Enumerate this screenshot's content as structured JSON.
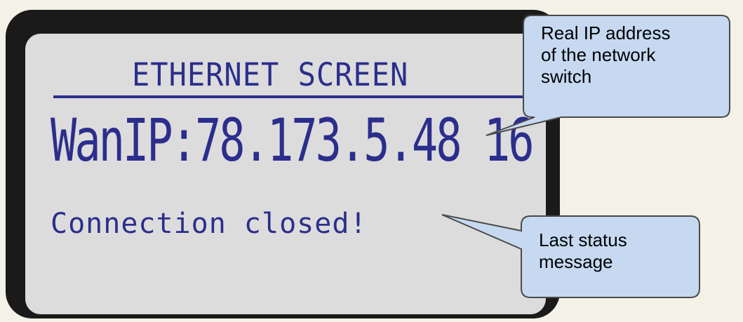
{
  "lcd": {
    "title": "ETHERNET SCREEN",
    "wan_ip_line": "WanIP:78.173.5.48 16",
    "status_line": "Connection closed!"
  },
  "callouts": {
    "ip_note_line1": "Real IP address",
    "ip_note_line2": "of the network",
    "ip_note_line3": "switch",
    "status_note_line1": "Last status",
    "status_note_line2": "message"
  },
  "colors": {
    "lcd_text": "#2b2e8c",
    "lcd_background": "#dcdcdc",
    "frame": "#1a1a1a",
    "callout_fill": "#c6d9f1",
    "callout_border": "#4a4a4a"
  }
}
